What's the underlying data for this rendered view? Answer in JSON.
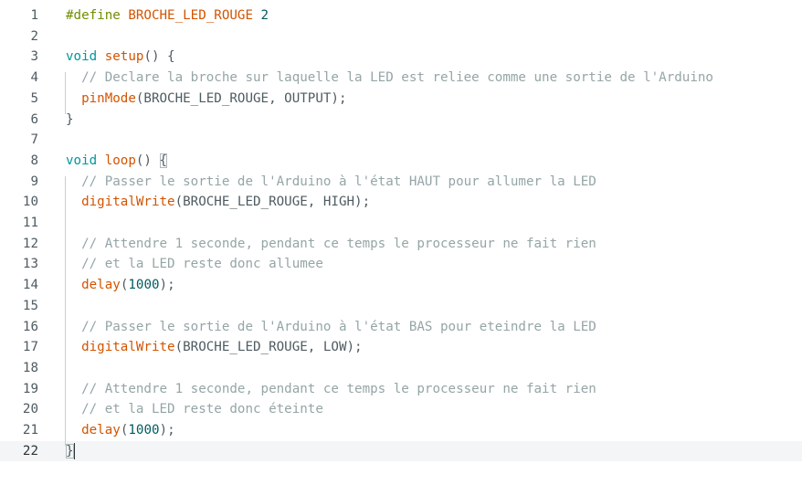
{
  "editor": {
    "current_line": 22,
    "lines": [
      {
        "n": "1",
        "tokens": [
          {
            "t": "#define ",
            "c": "dir"
          },
          {
            "t": "BROCHE_LED_ROUGE",
            "c": "fn"
          },
          {
            "t": " 2",
            "c": "num"
          }
        ]
      },
      {
        "n": "2",
        "tokens": []
      },
      {
        "n": "3",
        "tokens": [
          {
            "t": "void",
            "c": "kw"
          },
          {
            "t": " ",
            "c": "txt"
          },
          {
            "t": "setup",
            "c": "fn"
          },
          {
            "t": "() {",
            "c": "txt"
          }
        ]
      },
      {
        "n": "4",
        "tokens": [
          {
            "t": "  // Declare la broche sur laquelle la LED est reliee comme une sortie de l'Arduino",
            "c": "com"
          }
        ]
      },
      {
        "n": "5",
        "tokens": [
          {
            "t": "  ",
            "c": "txt"
          },
          {
            "t": "pinMode",
            "c": "fn"
          },
          {
            "t": "(BROCHE_LED_ROUGE, OUTPUT);",
            "c": "txt"
          }
        ]
      },
      {
        "n": "6",
        "tokens": [
          {
            "t": "}",
            "c": "txt"
          }
        ]
      },
      {
        "n": "7",
        "tokens": []
      },
      {
        "n": "8",
        "tokens": [
          {
            "t": "void",
            "c": "kw"
          },
          {
            "t": " ",
            "c": "txt"
          },
          {
            "t": "loop",
            "c": "fn"
          },
          {
            "t": "() ",
            "c": "txt"
          },
          {
            "t": "{",
            "c": "txt",
            "match": true
          }
        ]
      },
      {
        "n": "9",
        "tokens": [
          {
            "t": "  // Passer le sortie de l'Arduino à l'état HAUT pour allumer la LED",
            "c": "com"
          }
        ]
      },
      {
        "n": "10",
        "tokens": [
          {
            "t": "  ",
            "c": "txt"
          },
          {
            "t": "digitalWrite",
            "c": "fn"
          },
          {
            "t": "(BROCHE_LED_ROUGE, HIGH);",
            "c": "txt"
          }
        ]
      },
      {
        "n": "11",
        "tokens": []
      },
      {
        "n": "12",
        "tokens": [
          {
            "t": "  // Attendre 1 seconde, pendant ce temps le processeur ne fait rien",
            "c": "com"
          }
        ]
      },
      {
        "n": "13",
        "tokens": [
          {
            "t": "  // et la LED reste donc allumee",
            "c": "com"
          }
        ]
      },
      {
        "n": "14",
        "tokens": [
          {
            "t": "  ",
            "c": "txt"
          },
          {
            "t": "delay",
            "c": "fn"
          },
          {
            "t": "(",
            "c": "txt"
          },
          {
            "t": "1000",
            "c": "num"
          },
          {
            "t": ");",
            "c": "txt"
          }
        ]
      },
      {
        "n": "15",
        "tokens": []
      },
      {
        "n": "16",
        "tokens": [
          {
            "t": "  // Passer le sortie de l'Arduino à l'état BAS pour eteindre la LED",
            "c": "com"
          }
        ]
      },
      {
        "n": "17",
        "tokens": [
          {
            "t": "  ",
            "c": "txt"
          },
          {
            "t": "digitalWrite",
            "c": "fn"
          },
          {
            "t": "(BROCHE_LED_ROUGE, LOW);",
            "c": "txt"
          }
        ]
      },
      {
        "n": "18",
        "tokens": []
      },
      {
        "n": "19",
        "tokens": [
          {
            "t": "  // Attendre 1 seconde, pendant ce temps le processeur ne fait rien",
            "c": "com"
          }
        ]
      },
      {
        "n": "20",
        "tokens": [
          {
            "t": "  // et la LED reste donc éteinte",
            "c": "com"
          }
        ]
      },
      {
        "n": "21",
        "tokens": [
          {
            "t": "  ",
            "c": "txt"
          },
          {
            "t": "delay",
            "c": "fn"
          },
          {
            "t": "(",
            "c": "txt"
          },
          {
            "t": "1000",
            "c": "num"
          },
          {
            "t": ");",
            "c": "txt"
          }
        ]
      },
      {
        "n": "22",
        "tokens": [
          {
            "t": "}",
            "c": "txt",
            "match": true,
            "cursor": true
          }
        ]
      }
    ]
  },
  "colors": {
    "directive": "#728e00",
    "keyword": "#00979d",
    "function": "#d35400",
    "number": "#005c5f",
    "comment": "#95a5a6",
    "text": "#4e5b61",
    "current_line_bg": "#f3f5f6"
  }
}
